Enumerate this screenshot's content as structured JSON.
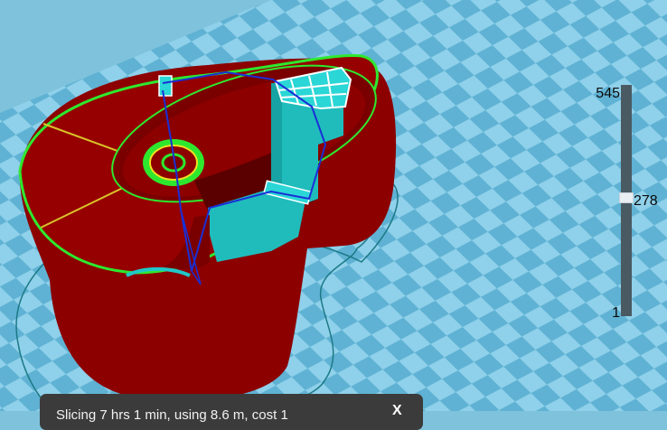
{
  "viewport": {
    "bed_colors": {
      "light": "#8fd0ea",
      "dark": "#5fb2d3",
      "background": "#7fc2dc"
    },
    "model_colors": {
      "wall": "#8c0000",
      "infill": "#20c8c8",
      "perimeter_green": "#2ee82e",
      "travel": "#1a2fd6"
    }
  },
  "layer_slider": {
    "max_label": "545",
    "current_label": "278",
    "min_label": "1",
    "current_fraction": 0.51
  },
  "toast": {
    "message": "Slicing 7 hrs 1 min, using 8.6 m, cost 1",
    "close_icon": "x-close-icon",
    "close_glyph": "X"
  }
}
